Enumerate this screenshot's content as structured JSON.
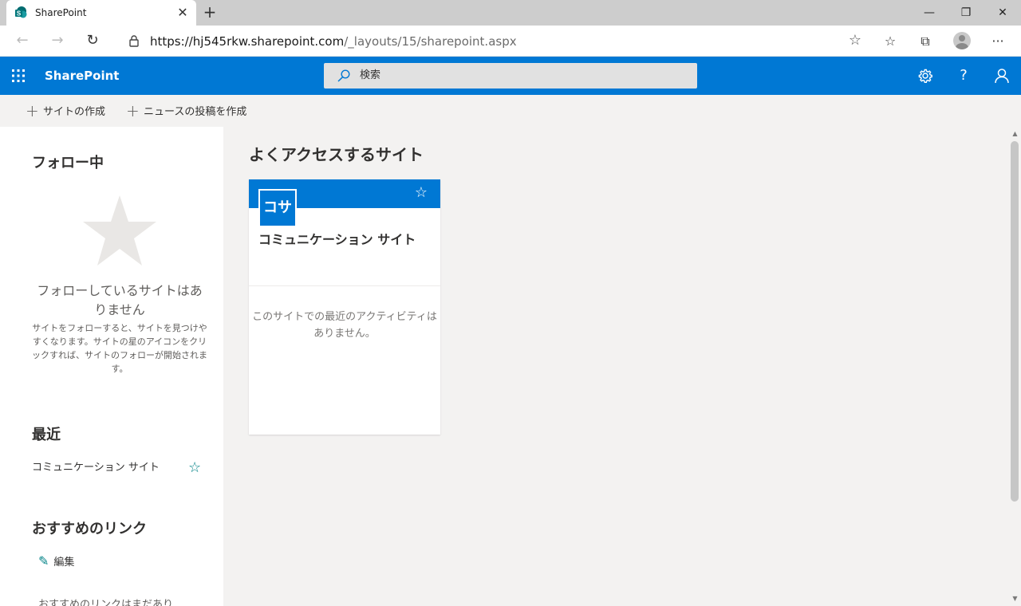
{
  "browser": {
    "tab_title": "SharePoint",
    "tab_close": "✕",
    "new_tab": "+",
    "url_host": "https://hj545rkw.sharepoint.com",
    "url_path": "/_layouts/15/sharepoint.aspx",
    "window_minimize": "—",
    "window_restore": "❐",
    "window_close": "✕",
    "more_menu": "···"
  },
  "suitebar": {
    "brand": "SharePoint",
    "search_placeholder": "検索",
    "help": "?"
  },
  "commands": {
    "create_site": "サイトの作成",
    "create_news": "ニュースの投稿を作成"
  },
  "left": {
    "following_title": "フォロー中",
    "following_empty_title": "フォローしているサイトはありません",
    "following_empty_desc": "サイトをフォローすると、サイトを見つけやすくなります。サイトの星のアイコンをクリックすれば、サイトのフォローが開始されます。",
    "recent_title": "最近",
    "recent_items": [
      {
        "label": "コミュニケーション サイト"
      }
    ],
    "featured_title": "おすすめのリンク",
    "edit_label": "編集",
    "featured_empty": "おすすめのリンクはまだあり"
  },
  "main": {
    "frequent_title": "よくアクセスするサイト",
    "card": {
      "logo_text": "コサ",
      "site_name": "コミュニケーション サイト",
      "activity_empty": "このサイトでの最近のアクティビティはありません。"
    }
  },
  "colors": {
    "brand_blue": "#0078d4",
    "teal": "#038387",
    "neutral_bg": "#f3f2f1"
  }
}
